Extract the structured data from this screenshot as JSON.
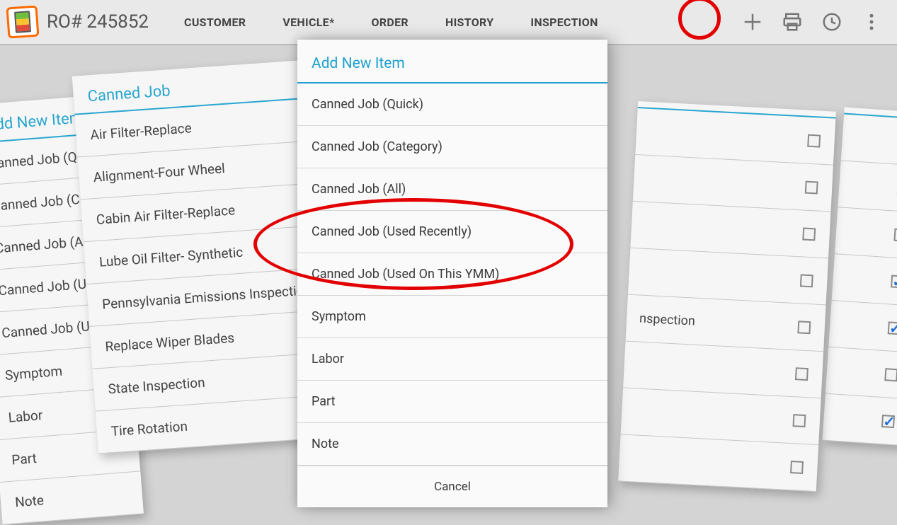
{
  "header": {
    "ro_label": "RO# 245852",
    "tabs": [
      "CUSTOMER",
      "VEHICLE*",
      "ORDER",
      "HISTORY",
      "INSPECTION"
    ],
    "icons": {
      "add": "plus-icon",
      "print": "printer-icon",
      "history": "clock-icon",
      "more": "more-vert-icon"
    }
  },
  "bg_left_a": {
    "title": "Add New Item",
    "items": [
      "Canned Job (Quick)",
      "Canned Job (Category)",
      "Canned Job (All)",
      "Canned Job (Used Recently)",
      "Canned Job (Used On This YMM)",
      "Symptom",
      "Labor",
      "Part",
      "Note"
    ]
  },
  "bg_left_b": {
    "title": "Canned Job",
    "items": [
      "Air Filter-Replace",
      "Alignment-Four Wheel",
      "Cabin Air Filter-Replace",
      "Lube Oil Filter- Synthetic",
      "Pennsylvania Emissions Inspection",
      "Replace Wiper Blades",
      "State Inspection",
      "Tire Rotation"
    ]
  },
  "bg_right2": {
    "rows": [
      {
        "label": "",
        "checked": false
      },
      {
        "label": "",
        "checked": false
      },
      {
        "label": "",
        "checked": false
      },
      {
        "label": "",
        "checked": false
      },
      {
        "label": "nspection",
        "checked": false
      },
      {
        "label": "",
        "checked": false
      },
      {
        "label": "",
        "checked": false
      },
      {
        "label": "",
        "checked": false
      }
    ]
  },
  "bg_right1": {
    "rows": [
      {
        "checked": false
      },
      {
        "checked": false
      },
      {
        "checked": false
      },
      {
        "checked": true
      },
      {
        "checked": true
      },
      {
        "checked": false
      },
      {
        "checked": true
      }
    ]
  },
  "dialog": {
    "title": "Add New Item",
    "items": [
      "Canned Job (Quick)",
      "Canned Job (Category)",
      "Canned Job (All)",
      "Canned Job (Used Recently)",
      "Canned Job (Used On This YMM)",
      "Symptom",
      "Labor",
      "Part",
      "Note"
    ],
    "cancel": "Cancel"
  }
}
